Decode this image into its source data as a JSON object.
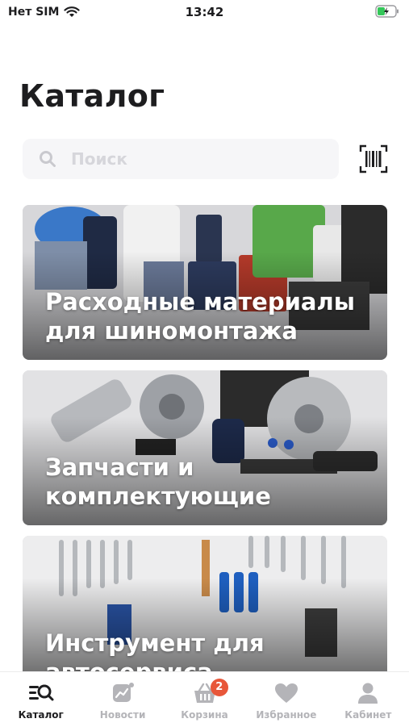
{
  "status_bar": {
    "carrier": "Нет SIM",
    "time": "13:42"
  },
  "header": {
    "title": "Каталог"
  },
  "search": {
    "placeholder": "Поиск"
  },
  "categories": [
    {
      "title": "Расходные материалы для шиномонтажа"
    },
    {
      "title": "Запчасти и комплектующие"
    },
    {
      "title": "Инструмент для автосервиса"
    }
  ],
  "tab_bar": {
    "items": [
      {
        "label": "Каталог",
        "icon": "catalog-search-icon",
        "active": true
      },
      {
        "label": "Новости",
        "icon": "news-chart-icon"
      },
      {
        "label": "Корзина",
        "icon": "basket-icon",
        "badge": "2"
      },
      {
        "label": "Избранное",
        "icon": "heart-icon"
      },
      {
        "label": "Кабинет",
        "icon": "person-icon"
      }
    ]
  },
  "colors": {
    "accent": "#e8573a",
    "text": "#1d1d1f",
    "inactive": "#b4b4b8"
  }
}
